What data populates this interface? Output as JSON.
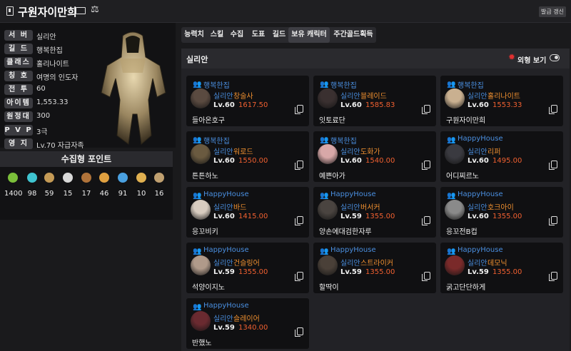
{
  "header": {
    "name": "구원자이만희",
    "refresh_label": "발급 갱신"
  },
  "profile": {
    "rows": [
      {
        "key": "서 버",
        "value": "실리안"
      },
      {
        "key": "길 드",
        "value": "행복한집"
      },
      {
        "key": "클래스",
        "value": "홀리나이트"
      },
      {
        "key": "칭 호",
        "value": "여명의 인도자"
      },
      {
        "key": "전 투",
        "value": "60"
      },
      {
        "key": "아이템",
        "value": "1,553.33"
      },
      {
        "key": "원정대",
        "value": "300"
      },
      {
        "key": "P V P",
        "value": "3극"
      },
      {
        "key": "영 지",
        "value": "Lv.70 자급자족"
      }
    ]
  },
  "collection": {
    "title": "수집형 포인트",
    "items": [
      {
        "icon": "mokoko-seed-icon",
        "color": "#7bbf3a",
        "value": "1400"
      },
      {
        "icon": "island-heart-icon",
        "color": "#3fc4d0",
        "value": "98"
      },
      {
        "icon": "great-art-icon",
        "color": "#c49a55",
        "value": "59"
      },
      {
        "icon": "giants-heart-icon",
        "color": "#d8d8d8",
        "value": "15"
      },
      {
        "icon": "ignea-token-icon",
        "color": "#b0733a",
        "value": "17"
      },
      {
        "icon": "adventure-tome-icon",
        "color": "#e0a040",
        "value": "46"
      },
      {
        "icon": "world-tree-leaf-icon",
        "color": "#4aa0e0",
        "value": "91"
      },
      {
        "icon": "orpheus-star-icon",
        "color": "#e0b050",
        "value": "10"
      },
      {
        "icon": "sea-bounty-icon",
        "color": "#c0a070",
        "value": "16"
      }
    ]
  },
  "tabs": [
    "능력치",
    "스킬",
    "수집",
    "도표",
    "길드",
    "보유 캐릭터",
    "주간골드획득"
  ],
  "active_tab": "보유 캐릭터",
  "panel": {
    "server": "실리안",
    "look_label": "외형 보기"
  },
  "characters": [
    {
      "guild": "행복한집",
      "server": "실리안",
      "class": "창술사",
      "level": "Lv.60",
      "item_level": "1617.50",
      "name": "들아온호구",
      "avatar_color": "#5a4a40"
    },
    {
      "guild": "행복한집",
      "server": "실리안",
      "class": "블레이드",
      "level": "Lv.60",
      "item_level": "1585.83",
      "name": "잇토료단",
      "avatar_color": "#3a3030"
    },
    {
      "guild": "행복한집",
      "server": "실리안",
      "class": "홀리나이트",
      "level": "Lv.60",
      "item_level": "1553.33",
      "name": "구원자이만희",
      "avatar_color": "#c9b090"
    },
    {
      "guild": "행복한집",
      "server": "실리안",
      "class": "워로드",
      "level": "Lv.60",
      "item_level": "1550.00",
      "name": "튼튼하노",
      "avatar_color": "#6a5a40"
    },
    {
      "guild": "행복한집",
      "server": "실리안",
      "class": "도화가",
      "level": "Lv.60",
      "item_level": "1540.00",
      "name": "예쁜아가",
      "avatar_color": "#d8a8a8"
    },
    {
      "guild": "HappyHouse",
      "server": "실리안",
      "class": "리퍼",
      "level": "Lv.60",
      "item_level": "1495.00",
      "name": "어디찌르노",
      "avatar_color": "#3a3a40"
    },
    {
      "guild": "HappyHouse",
      "server": "실리안",
      "class": "바드",
      "level": "Lv.60",
      "item_level": "1415.00",
      "name": "응꼬비키",
      "avatar_color": "#d8ccc0"
    },
    {
      "guild": "HappyHouse",
      "server": "실리안",
      "class": "버서커",
      "level": "Lv.59",
      "item_level": "1355.00",
      "name": "양손에대검한자루",
      "avatar_color": "#4a4440"
    },
    {
      "guild": "HappyHouse",
      "server": "실리안",
      "class": "호크아이",
      "level": "Lv.60",
      "item_level": "1355.00",
      "name": "응꼬전B컵",
      "avatar_color": "#8a8a8a"
    },
    {
      "guild": "HappyHouse",
      "server": "실리안",
      "class": "건슬링어",
      "level": "Lv.59",
      "item_level": "1355.00",
      "name": "석양이지노",
      "avatar_color": "#b09a8a"
    },
    {
      "guild": "HappyHouse",
      "server": "실리안",
      "class": "스트라이커",
      "level": "Lv.59",
      "item_level": "1355.00",
      "name": "할딱이",
      "avatar_color": "#4a4038"
    },
    {
      "guild": "HappyHouse",
      "server": "실리안",
      "class": "데모닉",
      "level": "Lv.59",
      "item_level": "1355.00",
      "name": "굵고단단하게",
      "avatar_color": "#7a2a2a"
    },
    {
      "guild": "HappyHouse",
      "server": "실리안",
      "class": "슬레이어",
      "level": "Lv.59",
      "item_level": "1340.00",
      "name": "반했노",
      "avatar_color": "#6a2a30"
    }
  ]
}
